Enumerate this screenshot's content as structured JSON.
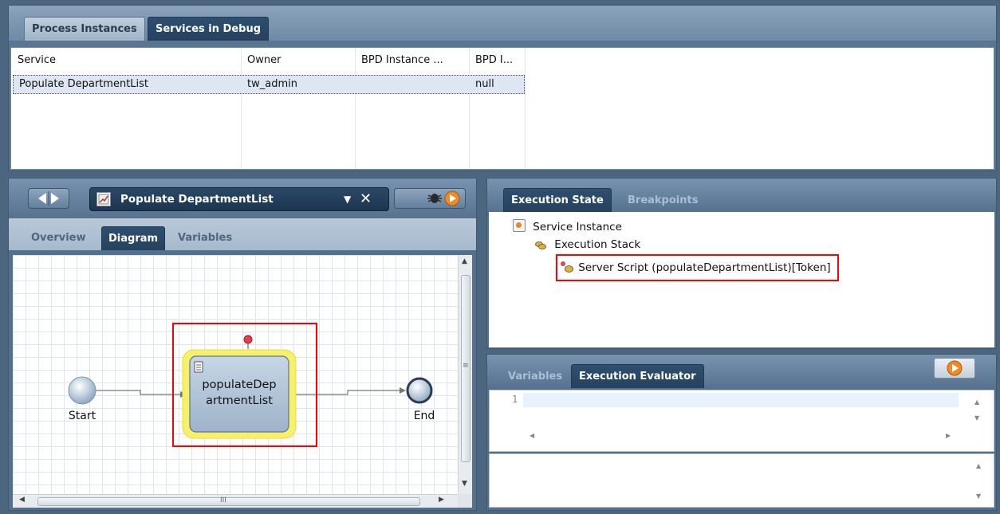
{
  "top_tabs": [
    "Process Instances",
    "Services in Debug"
  ],
  "services_table": {
    "columns": [
      "Service",
      "Owner",
      "BPD Instance ...",
      "BPD I..."
    ],
    "rows": [
      {
        "service": "Populate DepartmentList",
        "owner": "tw_admin",
        "bpd_instance": "",
        "bpd_id": "null"
      }
    ]
  },
  "diagram_editor": {
    "title": "Populate DepartmentList",
    "subtabs": [
      "Overview",
      "Diagram",
      "Variables"
    ],
    "nodes": {
      "start": "Start",
      "task_line1": "populateDep",
      "task_line2": "artmentList",
      "end": "End"
    },
    "hscroll_grip": "III"
  },
  "execution_panel": {
    "tabs": [
      "Execution State",
      "Breakpoints"
    ],
    "tree": {
      "root": "Service Instance",
      "child": "Execution Stack",
      "leaf": "Server Script (populateDepartmentList)[Token]"
    }
  },
  "evaluator_panel": {
    "tabs": [
      "Variables",
      "Execution Evaluator"
    ],
    "line_number": "1"
  },
  "colors": {
    "highlight_box": "#ff0000",
    "active_tab": "#2a4a6b",
    "breakpoint_marker": "#e0424d",
    "play_button": "#f08a24",
    "task_outline": "#f6f06a"
  },
  "icons": [
    "back-icon",
    "forward-icon",
    "diagram-icon",
    "dropdown-icon",
    "close-icon",
    "bug-icon",
    "play-icon",
    "service-instance-icon",
    "stack-icon",
    "script-icon",
    "breakpoint-icon",
    "task-script-icon",
    "scroll-arrow-icons"
  ]
}
